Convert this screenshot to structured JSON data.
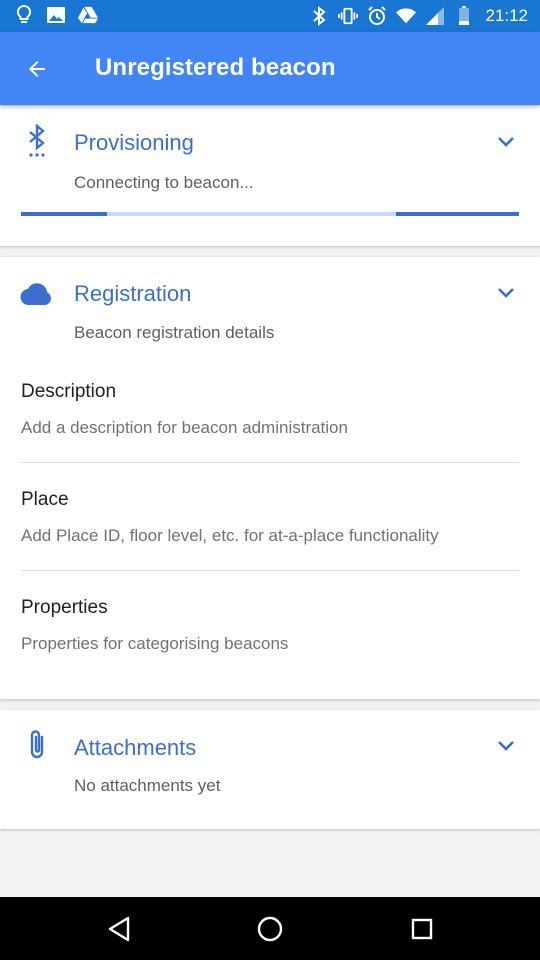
{
  "status_bar": {
    "time": "21:12",
    "left_icons": [
      "lightbulb-icon",
      "image-icon",
      "drive-icon"
    ],
    "right_icons": [
      "bluetooth-icon",
      "vibrate-icon",
      "alarm-icon",
      "wifi-icon",
      "signal-icon",
      "battery-icon"
    ]
  },
  "app_bar": {
    "title": "Unregistered beacon"
  },
  "provisioning": {
    "title": "Provisioning",
    "subtitle": "Connecting to beacon...",
    "icon": "bluetooth-searching-icon"
  },
  "registration": {
    "title": "Registration",
    "subtitle": "Beacon registration details",
    "icon": "cloud-icon",
    "fields": [
      {
        "label": "Description",
        "hint": "Add a description for beacon administration"
      },
      {
        "label": "Place",
        "hint": "Add Place ID, floor level, etc. for at-a-place functionality"
      },
      {
        "label": "Properties",
        "hint": "Properties for categorising beacons"
      }
    ]
  },
  "attachments": {
    "title": "Attachments",
    "subtitle": "No attachments yet",
    "icon": "paperclip-icon"
  },
  "colors": {
    "status_bar": "#1976d2",
    "app_bar": "#4285f4",
    "accent": "#3a6fd0",
    "progress_track": "#c6dafc"
  },
  "nav_bar": {
    "icons": [
      "back-triangle-icon",
      "home-circle-icon",
      "recents-square-icon"
    ]
  }
}
